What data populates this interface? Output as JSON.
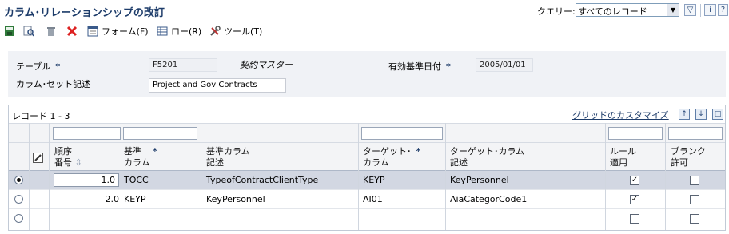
{
  "window": {
    "title": "カラム･リレーションシップの改訂"
  },
  "query": {
    "label": "クエリー:",
    "selected": "すべてのレコード"
  },
  "toolbar": {
    "form_label": "フォーム(F)",
    "row_label": "ロー(R)",
    "tools_label": "ツール(T)"
  },
  "header": {
    "table_label": "テーブル",
    "table_value": "F5201",
    "table_desc": "契約マスター",
    "effective_label": "有効基準日付",
    "effective_value": "2005/01/01",
    "colset_label": "カラム･セット記述",
    "colset_value": "Project and Gov Contracts",
    "required_mark": "*"
  },
  "grid": {
    "records_label": "レコード 1 - 3",
    "customize_label": "グリッドのカスタマイズ",
    "columns": {
      "seq": [
        "順序",
        "番号"
      ],
      "base_col": [
        "基準",
        "カラム"
      ],
      "base_desc": [
        "基準カラム",
        "記述"
      ],
      "target_col": [
        "ターゲット･",
        "カラム"
      ],
      "target_desc": [
        "ターゲット･カラム",
        "記述"
      ],
      "rule": [
        "ルール",
        "適用"
      ],
      "blank": [
        "ブランク",
        "許可"
      ]
    },
    "rows": [
      {
        "seq": "1.0",
        "base_col": "TOCC",
        "base_desc": "TypeofContractClientType",
        "target_col": "KEYP",
        "target_desc": "KeyPersonnel",
        "rule": "✓",
        "blank": "",
        "selected": true
      },
      {
        "seq": "2.0",
        "base_col": "KEYP",
        "base_desc": "KeyPersonnel",
        "target_col": "AI01",
        "target_desc": "AiaCategorCode1",
        "rule": "✓",
        "blank": "",
        "selected": false
      },
      {
        "seq": "",
        "base_col": "",
        "base_desc": "",
        "target_col": "",
        "target_desc": "",
        "rule": "",
        "blank": "",
        "selected": false
      }
    ]
  },
  "colors": {
    "title": "#1d3c6a",
    "selected_row": "#d2d7e2",
    "header_bg": "#f0f2f6"
  }
}
